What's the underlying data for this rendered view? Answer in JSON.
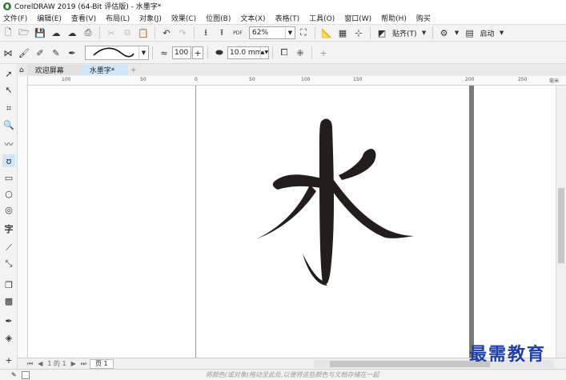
{
  "window": {
    "title": "CorelDRAW 2019 (64-Bit 评估版) - 水墨字*"
  },
  "menu": [
    "文件(F)",
    "编辑(E)",
    "查看(V)",
    "布局(L)",
    "对象(J)",
    "效果(C)",
    "位图(B)",
    "文本(X)",
    "表格(T)",
    "工具(O)",
    "窗口(W)",
    "帮助(H)",
    "购买"
  ],
  "toolbar": {
    "zoom": "62%",
    "paste_label": "贴齐(T)",
    "start_label": "启动",
    "pdf_label": "PDF"
  },
  "property_bar": {
    "smoothing_value": "100",
    "width_value": "10.0 mm"
  },
  "tabs": {
    "welcome": "欢迎屏幕",
    "document": "水墨字*"
  },
  "ruler": {
    "h_labels": [
      "100",
      "50",
      "0",
      "50",
      "100",
      "150",
      "200",
      "250"
    ],
    "unit": "毫米"
  },
  "artwork": {
    "character": "水",
    "ink_color": "#221e1c"
  },
  "bottom": {
    "page_label": "页 1",
    "page_counter": "1 的 1"
  },
  "status": {
    "hint": "将颜色(或对象)拖动至此处,以便将这些颜色与文档存储在一起"
  },
  "watermark": "最需教育"
}
